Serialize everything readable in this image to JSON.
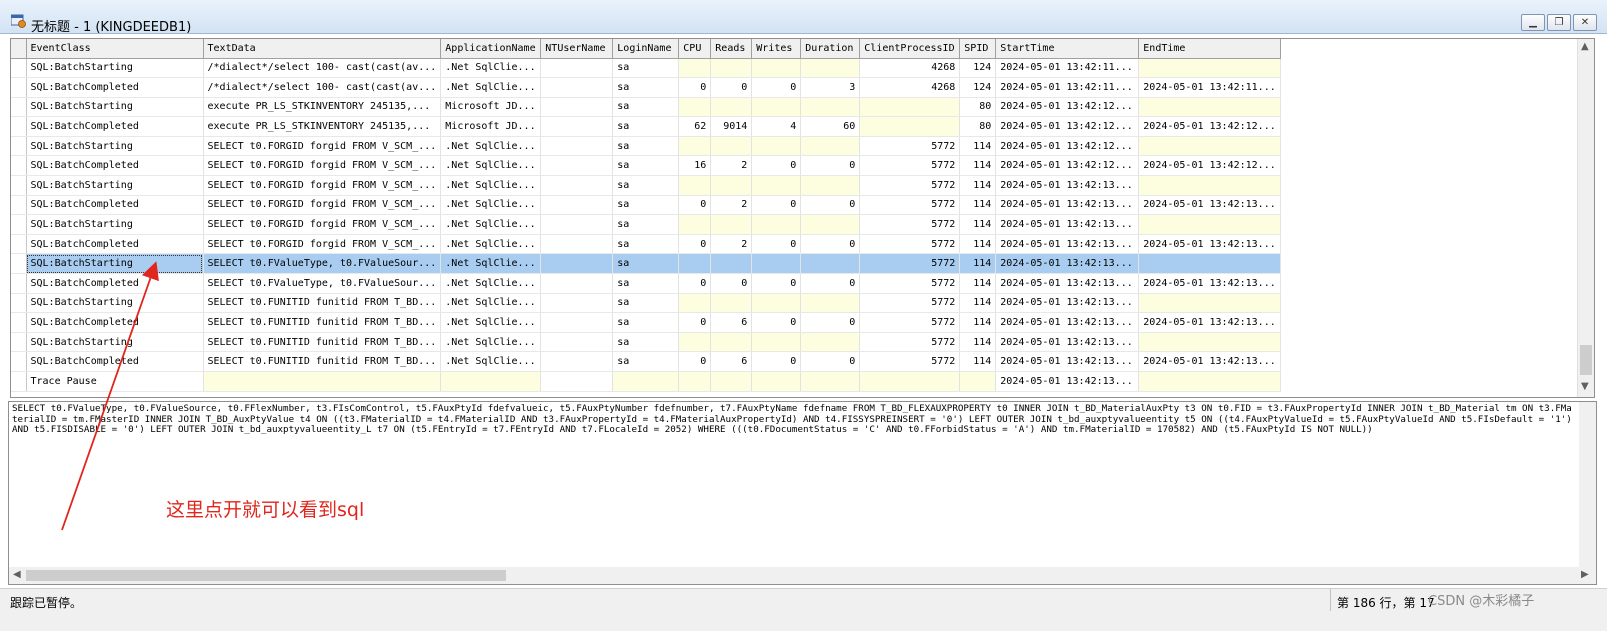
{
  "window": {
    "title": "无标题 - 1 (KINGDEEDB1)"
  },
  "columns": [
    "EventClass",
    "TextData",
    "ApplicationName",
    "NTUserName",
    "LoginName",
    "CPU",
    "Reads",
    "Writes",
    "Duration",
    "ClientProcessID",
    "SPID",
    "StartTime",
    "EndTime"
  ],
  "rows": [
    {
      "event": "SQL:BatchStarting",
      "text": "/*dialect*/select 100- cast(cast(av...",
      "app": ".Net SqlClie...",
      "ntuser": "",
      "login": "sa",
      "cpu": "",
      "reads": "",
      "writes": "",
      "duration": "",
      "cpid": "4268",
      "spid": "124",
      "start": "2024-05-01 13:42:11...",
      "end": ""
    },
    {
      "event": "SQL:BatchCompleted",
      "text": "/*dialect*/select 100- cast(cast(av...",
      "app": ".Net SqlClie...",
      "ntuser": "",
      "login": "sa",
      "cpu": "0",
      "reads": "0",
      "writes": "0",
      "duration": "3",
      "cpid": "4268",
      "spid": "124",
      "start": "2024-05-01 13:42:11...",
      "end": "2024-05-01 13:42:11..."
    },
    {
      "event": "SQL:BatchStarting",
      "text": " execute PR_LS_STKINVENTORY 245135,...",
      "app": "Microsoft JD...",
      "ntuser": "",
      "login": "sa",
      "cpu": "",
      "reads": "",
      "writes": "",
      "duration": "",
      "cpid": "",
      "spid": "80",
      "start": "2024-05-01 13:42:12...",
      "end": ""
    },
    {
      "event": "SQL:BatchCompleted",
      "text": " execute PR_LS_STKINVENTORY 245135,...",
      "app": "Microsoft JD...",
      "ntuser": "",
      "login": "sa",
      "cpu": "62",
      "reads": "9014",
      "writes": "4",
      "duration": "60",
      "cpid": "",
      "spid": "80",
      "start": "2024-05-01 13:42:12...",
      "end": "2024-05-01 13:42:12..."
    },
    {
      "event": "SQL:BatchStarting",
      "text": "SELECT t0.FORGID forgid FROM V_SCM_...",
      "app": ".Net SqlClie...",
      "ntuser": "",
      "login": "sa",
      "cpu": "",
      "reads": "",
      "writes": "",
      "duration": "",
      "cpid": "5772",
      "spid": "114",
      "start": "2024-05-01 13:42:12...",
      "end": ""
    },
    {
      "event": "SQL:BatchCompleted",
      "text": "SELECT t0.FORGID forgid FROM V_SCM_...",
      "app": ".Net SqlClie...",
      "ntuser": "",
      "login": "sa",
      "cpu": "16",
      "reads": "2",
      "writes": "0",
      "duration": "0",
      "cpid": "5772",
      "spid": "114",
      "start": "2024-05-01 13:42:12...",
      "end": "2024-05-01 13:42:12..."
    },
    {
      "event": "SQL:BatchStarting",
      "text": "SELECT t0.FORGID forgid FROM V_SCM_...",
      "app": ".Net SqlClie...",
      "ntuser": "",
      "login": "sa",
      "cpu": "",
      "reads": "",
      "writes": "",
      "duration": "",
      "cpid": "5772",
      "spid": "114",
      "start": "2024-05-01 13:42:13...",
      "end": ""
    },
    {
      "event": "SQL:BatchCompleted",
      "text": "SELECT t0.FORGID forgid FROM V_SCM_...",
      "app": ".Net SqlClie...",
      "ntuser": "",
      "login": "sa",
      "cpu": "0",
      "reads": "2",
      "writes": "0",
      "duration": "0",
      "cpid": "5772",
      "spid": "114",
      "start": "2024-05-01 13:42:13...",
      "end": "2024-05-01 13:42:13..."
    },
    {
      "event": "SQL:BatchStarting",
      "text": "SELECT t0.FORGID forgid FROM V_SCM_...",
      "app": ".Net SqlClie...",
      "ntuser": "",
      "login": "sa",
      "cpu": "",
      "reads": "",
      "writes": "",
      "duration": "",
      "cpid": "5772",
      "spid": "114",
      "start": "2024-05-01 13:42:13...",
      "end": ""
    },
    {
      "event": "SQL:BatchCompleted",
      "text": "SELECT t0.FORGID forgid FROM V_SCM_...",
      "app": ".Net SqlClie...",
      "ntuser": "",
      "login": "sa",
      "cpu": "0",
      "reads": "2",
      "writes": "0",
      "duration": "0",
      "cpid": "5772",
      "spid": "114",
      "start": "2024-05-01 13:42:13...",
      "end": "2024-05-01 13:42:13..."
    },
    {
      "event": "SQL:BatchStarting",
      "text": "SELECT t0.FValueType, t0.FValueSour...",
      "app": ".Net SqlClie...",
      "ntuser": "",
      "login": "sa",
      "cpu": "",
      "reads": "",
      "writes": "",
      "duration": "",
      "cpid": "5772",
      "spid": "114",
      "start": "2024-05-01 13:42:13...",
      "end": "",
      "selected": true
    },
    {
      "event": "SQL:BatchCompleted",
      "text": "SELECT t0.FValueType, t0.FValueSour...",
      "app": ".Net SqlClie...",
      "ntuser": "",
      "login": "sa",
      "cpu": "0",
      "reads": "0",
      "writes": "0",
      "duration": "0",
      "cpid": "5772",
      "spid": "114",
      "start": "2024-05-01 13:42:13...",
      "end": "2024-05-01 13:42:13..."
    },
    {
      "event": "SQL:BatchStarting",
      "text": "SELECT t0.FUNITID funitid FROM T_BD...",
      "app": ".Net SqlClie...",
      "ntuser": "",
      "login": "sa",
      "cpu": "",
      "reads": "",
      "writes": "",
      "duration": "",
      "cpid": "5772",
      "spid": "114",
      "start": "2024-05-01 13:42:13...",
      "end": ""
    },
    {
      "event": "SQL:BatchCompleted",
      "text": "SELECT t0.FUNITID funitid FROM T_BD...",
      "app": ".Net SqlClie...",
      "ntuser": "",
      "login": "sa",
      "cpu": "0",
      "reads": "6",
      "writes": "0",
      "duration": "0",
      "cpid": "5772",
      "spid": "114",
      "start": "2024-05-01 13:42:13...",
      "end": "2024-05-01 13:42:13..."
    },
    {
      "event": "SQL:BatchStarting",
      "text": "SELECT t0.FUNITID funitid FROM T_BD...",
      "app": ".Net SqlClie...",
      "ntuser": "",
      "login": "sa",
      "cpu": "",
      "reads": "",
      "writes": "",
      "duration": "",
      "cpid": "5772",
      "spid": "114",
      "start": "2024-05-01 13:42:13...",
      "end": ""
    },
    {
      "event": "SQL:BatchCompleted",
      "text": "SELECT t0.FUNITID funitid FROM T_BD...",
      "app": ".Net SqlClie...",
      "ntuser": "",
      "login": "sa",
      "cpu": "0",
      "reads": "6",
      "writes": "0",
      "duration": "0",
      "cpid": "5772",
      "spid": "114",
      "start": "2024-05-01 13:42:13...",
      "end": "2024-05-01 13:42:13..."
    },
    {
      "event": "Trace Pause",
      "text": "",
      "app": "",
      "ntuser": "",
      "login": "",
      "cpu": "",
      "reads": "",
      "writes": "",
      "duration": "",
      "cpid": "",
      "spid": "",
      "start": "2024-05-01 13:42:13...",
      "end": ""
    }
  ],
  "sql_text": "SELECT t0.FValueType, t0.FValueSource, t0.FFlexNumber, t3.FIsComControl, t5.FAuxPtyId fdefvalueic, t5.FAuxPtyNumber fdefnumber, t7.FAuxPtyName fdefname FROM T_BD_FLEXAUXPROPERTY t0 INNER JOIN t_BD_MaterialAuxPty t3 ON t0.FID = t3.FAuxPropertyId INNER JOIN t_BD_Material tm ON t3.FMaterialID = tm.FMasterID INNER JOIN T_BD_AuxPtyValue t4 ON ((t3.FMaterialID = t4.FMaterialID AND t3.FAuxPropertyId = t4.FMaterialAuxPropertyId) AND t4.FISSYSPREINSERT = '0') LEFT OUTER JOIN t_bd_auxptyvalueentity t5 ON ((t4.FAuxPtyValueId = t5.FAuxPtyValueId AND t5.FIsDefault = '1') AND t5.FISDISABLE = '0') LEFT OUTER JOIN t_bd_auxptyvalueentity_L t7 ON (t5.FEntryId = t7.FEntryId AND t7.FLocaleId = 2052) WHERE (((t0.FDocumentStatus = 'C' AND t0.FForbidStatus = 'A') AND tm.FMaterialID = 170582) AND (t5.FAuxPtyId IS NOT NULL))",
  "annotation": "这里点开就可以看到sql",
  "status": {
    "left": "跟踪已暂停。",
    "right": "第 186 行，第 17"
  },
  "watermark": "CSDN @木彩橘子",
  "colors": {
    "selection": "#a8cdf1",
    "empty_cell": "#fdfde0",
    "annotation": "#e0261d"
  }
}
